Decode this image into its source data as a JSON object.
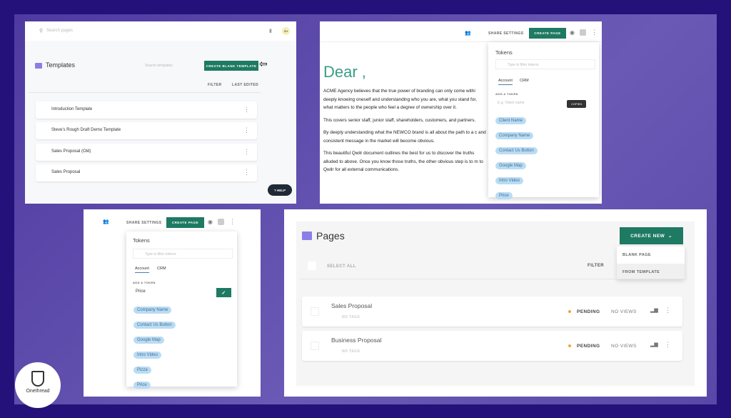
{
  "colors": {
    "accent": "#1e7a62",
    "background": "#24127a",
    "chip": "#b9dcf5",
    "pending": "#f0a830",
    "folder": "#8b7ee8"
  },
  "templates_panel": {
    "search_placeholder": "Search pages",
    "avatar": "SH",
    "title": "Templates",
    "search_templates_placeholder": "Search templates",
    "create_button": "CREATE BLANK TEMPLATE",
    "filter": "FILTER",
    "sort": "LAST EDITED",
    "items": [
      "Introduction Template",
      "Steve's Rough Draft Demo Template",
      "Sales Proposal (Old)",
      "Sales Proposal"
    ],
    "help": "HELP"
  },
  "editor_panel": {
    "share_settings": "SHARE SETTINGS",
    "create_page": "CREATE PAGE",
    "heading": "Dear ,",
    "paragraphs": [
      "ACME Agency believes that the true power of branding can only come withi deeply knowing oneself and understanding who you are, what you stand for, what matters to the people who feel a degree of ownership over it.",
      "This covers senior staff, junior staff, shareholders, customers, and partners.",
      "By deeply understanding what the NEWCO brand is all about the path to a c and consistent message in the market will become obvious.",
      "This beautiful Qwilr document outlines the best for us to discover the truths alluded to above. Once you know those truths, the other obvious step is to m to Qwilr for all external communications."
    ],
    "tokens": {
      "title": "Tokens",
      "filter_placeholder": "Type to filter tokens",
      "tabs": [
        "Account",
        "CRM"
      ],
      "add_label": "ADD A TOKEN",
      "add_placeholder": "E.g. Token name",
      "tooltip": "COPIED",
      "chips": [
        "Client Name",
        "Company Name",
        "Contact Us Button",
        "Google Map",
        "Intro Video",
        "Price"
      ]
    }
  },
  "tokens_panel": {
    "share_settings": "SHARE SETTINGS",
    "create_page": "CREATE PAGE",
    "title": "Tokens",
    "filter_placeholder": "Type to filter tokens",
    "tabs": [
      "Account",
      "CRM"
    ],
    "add_label": "ADD A TOKEN",
    "add_value": "Price",
    "chips": [
      "Company Name",
      "Contact Us Button",
      "Google Map",
      "Intro Video",
      "Pizza",
      "Price"
    ]
  },
  "pages_panel": {
    "title": "Pages",
    "create_new": "CREATE NEW",
    "menu": [
      "BLANK PAGE",
      "FROM TEMPLATE"
    ],
    "select_all": "SELECT ALL",
    "filter": "FILTER",
    "rows": [
      {
        "name": "Sales Proposal",
        "tags": "NO TAGS",
        "status": "PENDING",
        "views": "NO VIEWS"
      },
      {
        "name": "Business Proposal",
        "tags": "NO TAGS",
        "status": "PENDING",
        "views": "NO VIEWS"
      }
    ]
  },
  "logo": {
    "text": "Onethread"
  }
}
